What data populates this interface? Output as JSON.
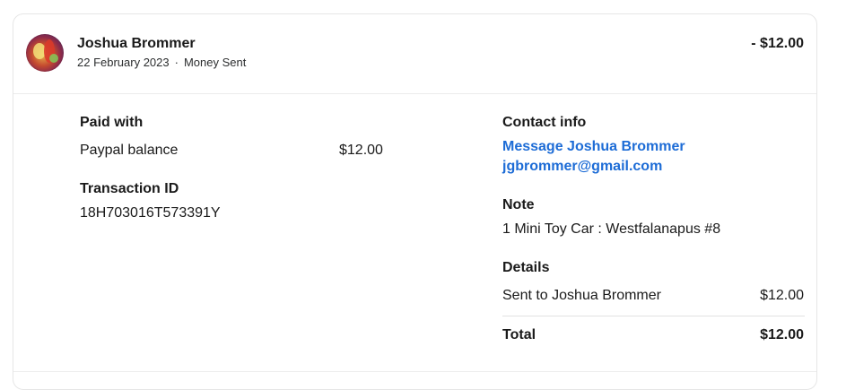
{
  "transaction": {
    "name": "Joshua Brommer",
    "date": "22 February 2023",
    "separator": "·",
    "type": "Money Sent",
    "amount": "- $12.00"
  },
  "paid_with": {
    "label": "Paid with",
    "method": "Paypal balance",
    "amount": "$12.00"
  },
  "transaction_id": {
    "label": "Transaction ID",
    "value": "18H703016T573391Y"
  },
  "contact": {
    "label": "Contact info",
    "message_link": "Message Joshua Brommer",
    "email": "jgbrommer@gmail.com"
  },
  "note": {
    "label": "Note",
    "value": "1 Mini Toy Car : Westfalanapus #8"
  },
  "details": {
    "label": "Details",
    "line_label": "Sent to Joshua Brommer",
    "line_amount": "$12.00",
    "total_label": "Total",
    "total_amount": "$12.00"
  }
}
